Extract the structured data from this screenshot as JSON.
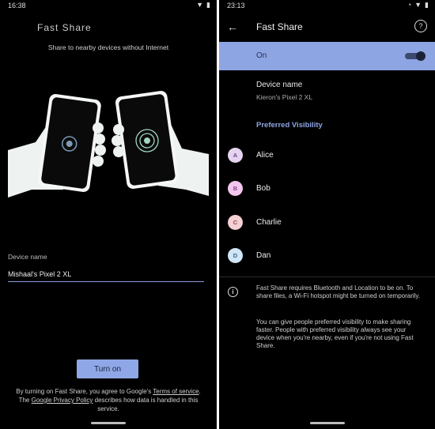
{
  "left": {
    "status": {
      "time": "16:38"
    },
    "app_title": "Fast Share",
    "subtitle": "Share to nearby devices without Internet",
    "device_name_label": "Device name",
    "device_name_value": "Mishaal's Pixel 2 XL",
    "turn_on_button": "Turn on",
    "legal": {
      "part1": "By turning on Fast Share, you agree to Google's ",
      "terms_link": "Terms of service",
      "part2": ". The ",
      "privacy_link": "Google Privacy Policy",
      "part3": " describes how data is handled in this service."
    }
  },
  "right": {
    "status": {
      "time": "23:13"
    },
    "title": "Fast Share",
    "toggle_row": {
      "label": "On",
      "checked": true
    },
    "device_name": {
      "title": "Device name",
      "value": "Kieron's Pixel 2 XL"
    },
    "preferred_header": "Preferred Visibility",
    "contacts": [
      {
        "initial": "A",
        "name": "Alice",
        "bg": "#e6d3f0",
        "fg": "#6e4a86"
      },
      {
        "initial": "B",
        "name": "Bob",
        "bg": "#f2c6ef",
        "fg": "#874a82"
      },
      {
        "initial": "C",
        "name": "Charlie",
        "bg": "#f4cfd3",
        "fg": "#8a4a54"
      },
      {
        "initial": "D",
        "name": "Dan",
        "bg": "#cfe6f7",
        "fg": "#3f6486"
      }
    ],
    "info_text_1": "Fast Share requires Bluetooth and Location to be on. To share files, a Wi-Fi hotspot might be turned on temporarily.",
    "info_text_2": "You can give people preferred visibility to make sharing faster. People with preferred visibility always see your device when you're nearby, even if you're not using Fast Share."
  },
  "colors": {
    "accent": "#8ea5e4",
    "background": "#000000"
  },
  "icons": [
    "back-arrow-icon",
    "help-icon",
    "info-icon",
    "wifi-icon",
    "battery-icon"
  ]
}
